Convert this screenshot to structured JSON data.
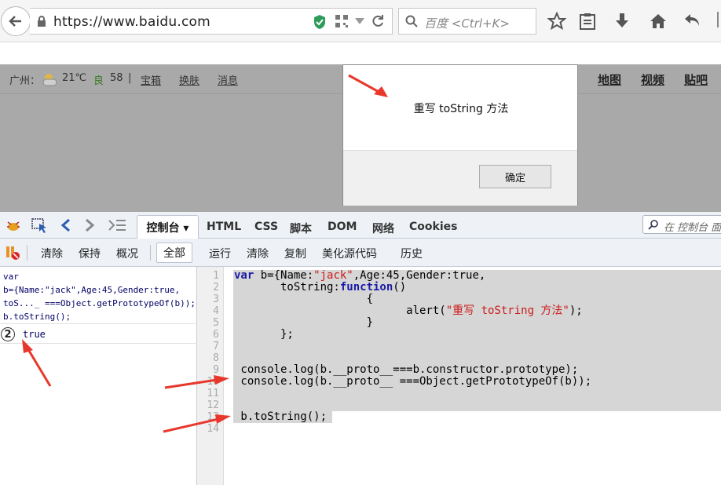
{
  "browser": {
    "url": "https://www.baidu.com",
    "search_placeholder": "百度 <Ctrl+K>"
  },
  "page": {
    "location_label": "广州：",
    "temperature": "21℃",
    "air_label": "良",
    "air_value": "58",
    "separator": "|",
    "links": [
      "宝箱",
      "换肤",
      "消息"
    ],
    "right_links": [
      "地图",
      "视频",
      "贴吧"
    ]
  },
  "alert": {
    "message": "重写 toString 方法",
    "ok_label": "确定"
  },
  "firebug": {
    "tabs": {
      "console": "控制台 ▾",
      "html": "HTML",
      "css": "CSS",
      "script": "脚本",
      "dom": "DOM",
      "net": "网络",
      "cookies": "Cookies"
    },
    "search_placeholder": "在 控制台 面",
    "actions": {
      "clear": "清除",
      "persist": "保持",
      "profile": "概况",
      "all": "全部",
      "run": "运行",
      "clear2": "清除",
      "copy": "复制",
      "beautify": "美化源代码",
      "history": "历史"
    },
    "log": {
      "code_lines": [
        "var",
        "b={Name:\"jack\",Age:45,Gender:true,",
        "toS..._ ===Object.getPrototypeOf(b));",
        "b.toString();"
      ],
      "badge": "2",
      "result": "true"
    },
    "editor": {
      "line_numbers": [
        "1",
        "2",
        "3",
        "4",
        "5",
        "6",
        "7",
        "8",
        "9",
        "10",
        "11",
        "12",
        "13",
        "14"
      ],
      "lines": [
        "var b={Name:\"jack\",Age:45,Gender:true,",
        "       toString:function()",
        "                    {",
        "                          alert(\"重写 toString 方法\");",
        "                    }",
        "       };",
        "",
        "",
        " console.log(b.__proto__===b.constructor.prototype);",
        " console.log(b.__proto__ ===Object.getPrototypeOf(b));",
        "",
        "",
        " b.toString();",
        ""
      ]
    }
  },
  "colors": {
    "dim_overlay": "#a9a9a9",
    "selection": "#d6d6d6",
    "keyword": "#1a1aa6",
    "string": "#cc1a1a",
    "arrow": "#e8382c"
  }
}
